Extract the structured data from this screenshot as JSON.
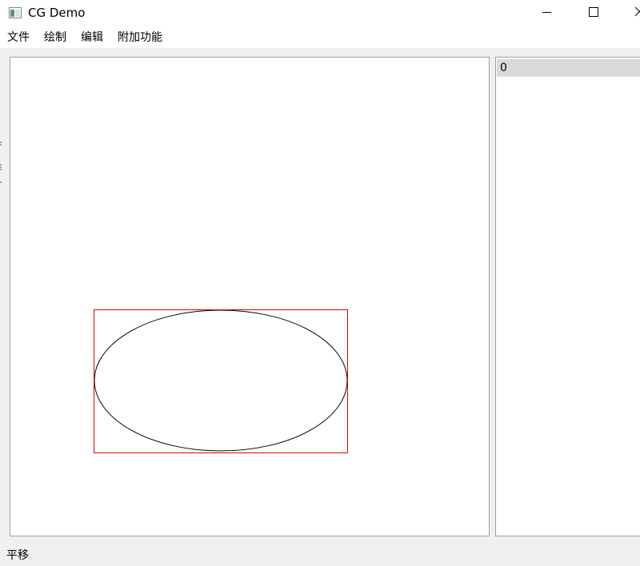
{
  "window": {
    "title": "CG Demo",
    "icon": "app-window-icon",
    "controls": {
      "minimize_icon": "minimize-icon",
      "maximize_icon": "maximize-icon",
      "close_icon": "close-icon"
    }
  },
  "menu": {
    "items": [
      {
        "label": "文件"
      },
      {
        "label": "绘制"
      },
      {
        "label": "编辑"
      },
      {
        "label": "附加功能"
      }
    ]
  },
  "canvas": {
    "background": "#ffffff",
    "shapes": [
      {
        "type": "ellipse",
        "stroke": "#000000",
        "selected": true
      }
    ],
    "selection_color": "#ff0000"
  },
  "item_list": {
    "items": [
      {
        "label": "0",
        "selected": true
      }
    ]
  },
  "statusbar": {
    "text": "平移"
  }
}
